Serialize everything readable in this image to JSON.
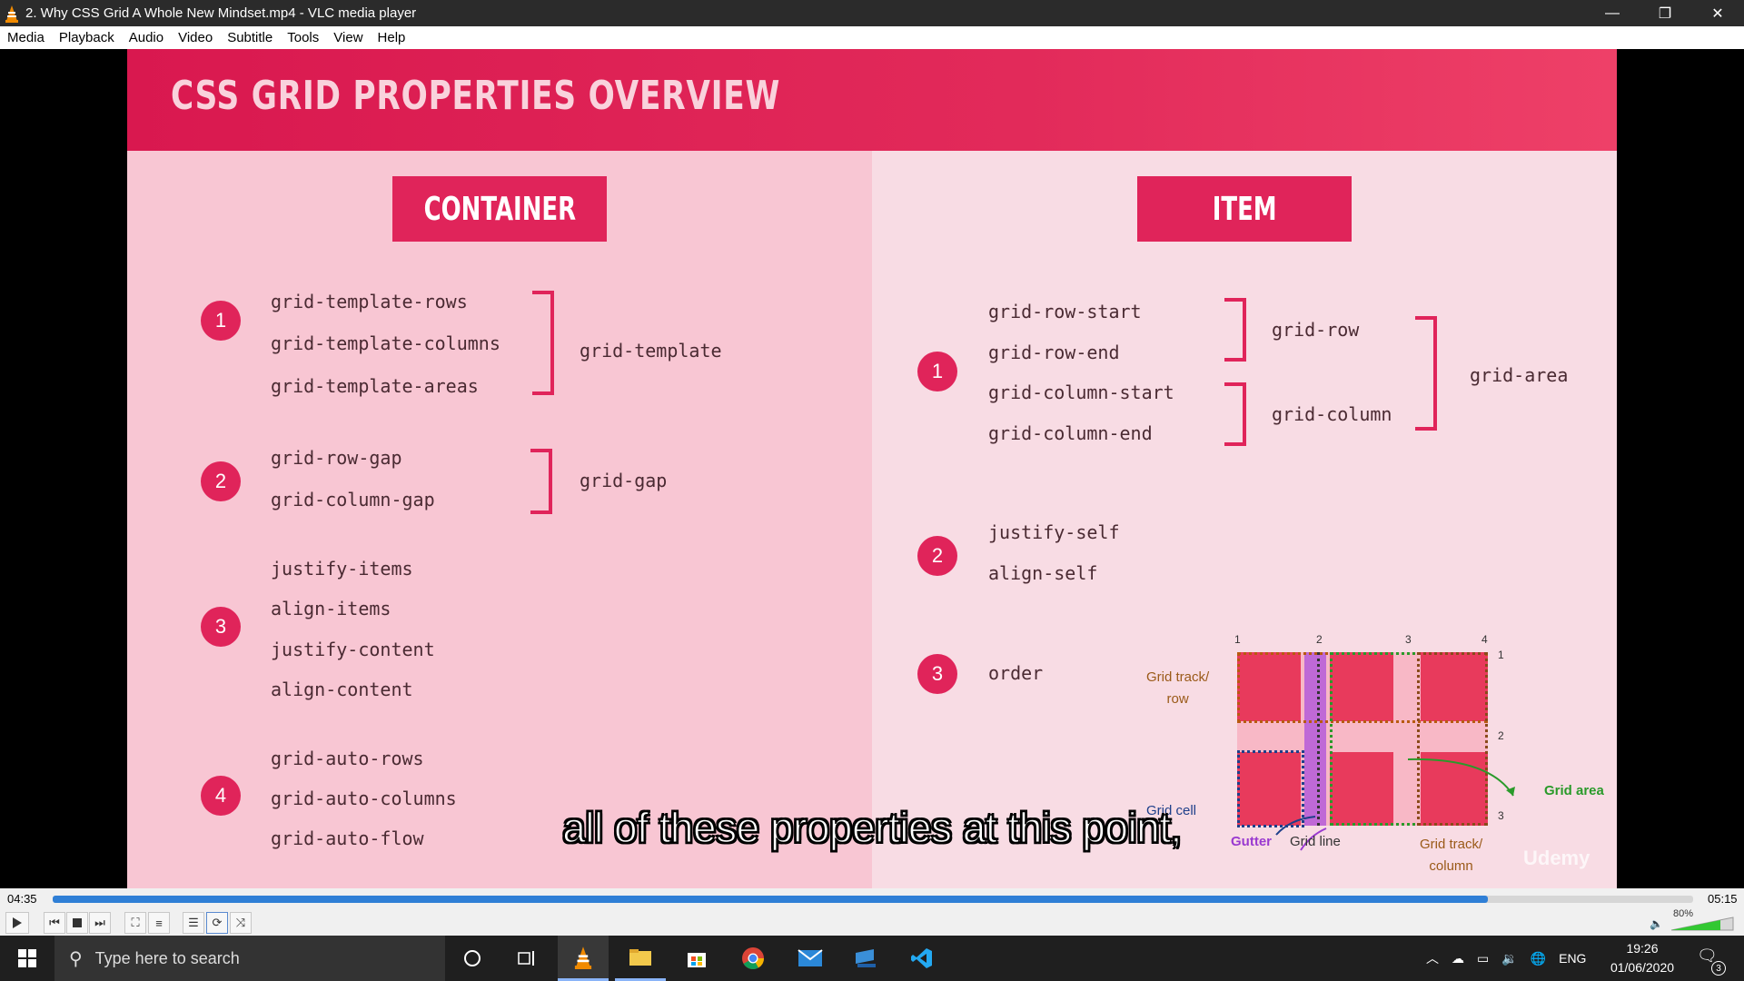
{
  "window": {
    "title": "2. Why CSS Grid A Whole New Mindset.mp4 - VLC media player",
    "minimize": "—",
    "restore": "❐",
    "close": "✕"
  },
  "menu": [
    "Media",
    "Playback",
    "Audio",
    "Video",
    "Subtitle",
    "Tools",
    "View",
    "Help"
  ],
  "slide": {
    "title": "CSS GRID PROPERTIES OVERVIEW",
    "container_label": "CONTAINER",
    "item_label": "ITEM",
    "container_groups": [
      {
        "num": "1",
        "props": [
          "grid-template-rows",
          "grid-template-columns",
          "grid-template-areas"
        ],
        "shorthand": "grid-template"
      },
      {
        "num": "2",
        "props": [
          "grid-row-gap",
          "grid-column-gap"
        ],
        "shorthand": "grid-gap"
      },
      {
        "num": "3",
        "props": [
          "justify-items",
          "align-items",
          "justify-content",
          "align-content"
        ]
      },
      {
        "num": "4",
        "props": [
          "grid-auto-rows",
          "grid-auto-columns",
          "grid-auto-flow"
        ]
      }
    ],
    "item_groups": [
      {
        "num": "1",
        "props": [
          "grid-row-start",
          "grid-row-end",
          "grid-column-start",
          "grid-column-end"
        ],
        "shorthand_row": "grid-row",
        "shorthand_col": "grid-column",
        "shorthand_area": "grid-area"
      },
      {
        "num": "2",
        "props": [
          "justify-self",
          "align-self"
        ]
      },
      {
        "num": "3",
        "props": [
          "order"
        ]
      }
    ],
    "diagram": {
      "col_numbers": [
        "1",
        "2",
        "3",
        "4"
      ],
      "row_numbers": [
        "1",
        "2",
        "3"
      ],
      "track_row_label": "Grid track/\nrow",
      "grid_cell_label": "Grid cell",
      "gutter_label": "Gutter",
      "grid_line_label": "Grid line",
      "track_col_label": "Grid track/\ncolumn",
      "grid_area_label": "Grid area"
    },
    "watermark": "Udemy"
  },
  "subtitle": "all of these properties at this point,",
  "player": {
    "elapsed": "04:35",
    "total": "05:15",
    "progress": 0.875,
    "volume": "80%"
  },
  "taskbar": {
    "search_placeholder": "Type here to search",
    "lang": "ENG",
    "time": "19:26",
    "date": "01/06/2020",
    "notifications": "3"
  },
  "colors": {
    "accent": "#e0245a",
    "slide_left": "#f8c6d3",
    "slide_right": "#f8dce4",
    "seek_fill": "#2f7fd6"
  }
}
